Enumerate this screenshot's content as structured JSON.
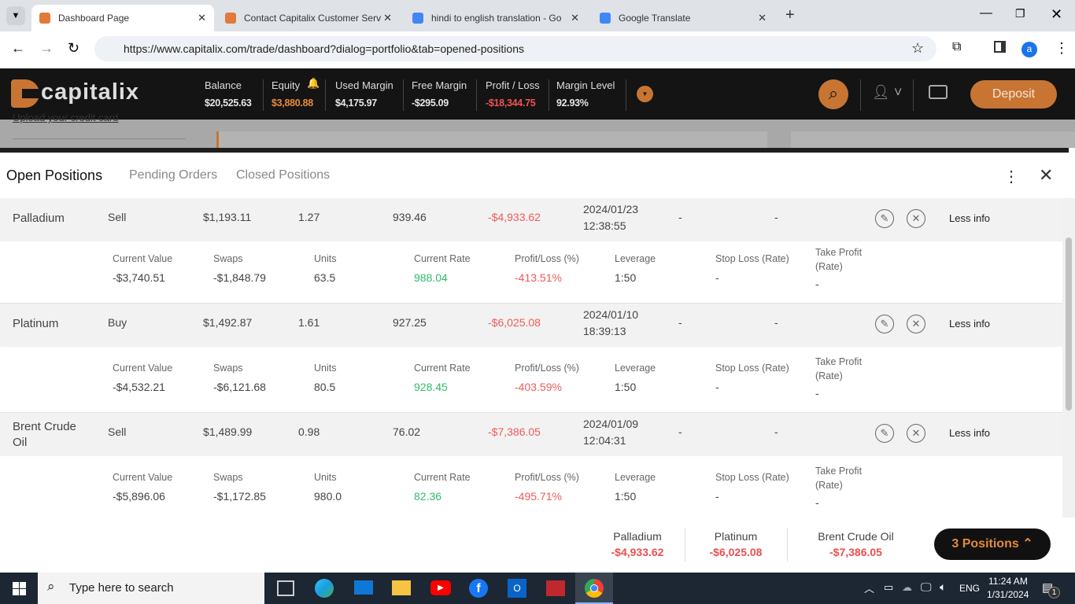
{
  "browser": {
    "tabs": [
      {
        "label": "Dashboard Page",
        "color": "#e07b39"
      },
      {
        "label": "Contact Capitalix Customer Serv",
        "color": "#e07b39"
      },
      {
        "label": "hindi to english translation - Go",
        "color": "#4285f4"
      },
      {
        "label": "Google Translate",
        "color": "#4285f4"
      }
    ],
    "url": "https://www.capitalix.com/trade/dashboard?dialog=portfolio&tab=opened-positions",
    "profile": "a"
  },
  "header": {
    "logo": "capitalix",
    "stats": [
      {
        "label": "Balance",
        "value": "$20,525.63"
      },
      {
        "label": "Equity",
        "value": "$3,880.88"
      },
      {
        "label": "Used Margin",
        "value": "$4,175.97"
      },
      {
        "label": "Free Margin",
        "value": "-$295.09"
      },
      {
        "label": "Profit / Loss",
        "value": "-$18,344.75"
      },
      {
        "label": "Margin Level",
        "value": "92.93%"
      }
    ],
    "deposit": "Deposit"
  },
  "background": {
    "upload_link": "Upload your credit card"
  },
  "panel": {
    "tabs": [
      "Open Positions",
      "Pending Orders",
      "Closed Positions"
    ],
    "detail_labels": [
      "Current Value",
      "Swaps",
      "Units",
      "Current Rate",
      "Profit/Loss (%)",
      "Leverage",
      "Stop Loss (Rate)",
      "Take Profit (Rate)"
    ],
    "less_info": "Less info",
    "positions": [
      {
        "name": "Palladium",
        "type": "Sell",
        "amount": "$1,193.11",
        "lots": "1.27",
        "open_rate": "939.46",
        "pl": "-$4,933.62",
        "date": "2024/01/23",
        "time": "12:38:55",
        "sl": "-",
        "tp": "-",
        "details": [
          "-$3,740.51",
          "-$1,848.79",
          "63.5",
          "988.04",
          "-413.51%",
          "1:50",
          "-",
          "-"
        ]
      },
      {
        "name": "Platinum",
        "type": "Buy",
        "amount": "$1,492.87",
        "lots": "1.61",
        "open_rate": "927.25",
        "pl": "-$6,025.08",
        "date": "2024/01/10",
        "time": "18:39:13",
        "sl": "-",
        "tp": "-",
        "details": [
          "-$4,532.21",
          "-$6,121.68",
          "80.5",
          "928.45",
          "-403.59%",
          "1:50",
          "-",
          "-"
        ]
      },
      {
        "name": "Brent Crude Oil",
        "type": "Sell",
        "amount": "$1,489.99",
        "lots": "0.98",
        "open_rate": "76.02",
        "pl": "-$7,386.05",
        "date": "2024/01/09",
        "time": "12:04:31",
        "sl": "-",
        "tp": "-",
        "details": [
          "-$5,896.06",
          "-$1,172.85",
          "980.0",
          "82.36",
          "-495.71%",
          "1:50",
          "-",
          "-"
        ]
      }
    ]
  },
  "footer": {
    "summary": [
      {
        "name": "Palladium",
        "pl": "-$4,933.62"
      },
      {
        "name": "Platinum",
        "pl": "-$6,025.08"
      },
      {
        "name": "Brent Crude Oil",
        "pl": "-$7,386.05"
      }
    ],
    "positions_button": "3 Positions"
  },
  "taskbar": {
    "search_placeholder": "Type here to search",
    "lang": "ENG",
    "time": "11:24 AM",
    "date": "1/31/2024",
    "notifications": "1"
  }
}
